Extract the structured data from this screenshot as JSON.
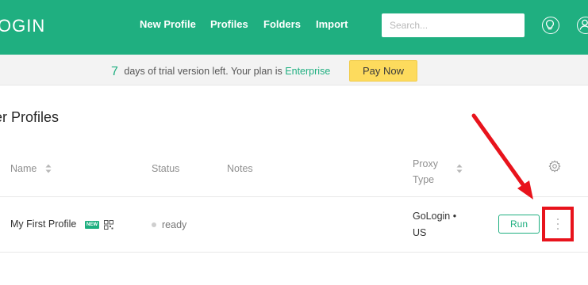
{
  "header": {
    "logo_text": "OGIN",
    "nav": [
      "New Profile",
      "Profiles",
      "Folders",
      "Import"
    ],
    "search_placeholder": "Search..."
  },
  "trial_banner": {
    "days": "7",
    "text": "days of trial version left. Your plan is",
    "plan": "Enterprise",
    "pay_label": "Pay Now"
  },
  "main": {
    "title": "er Profiles",
    "columns": [
      "Name",
      "Status",
      "Notes",
      "Proxy\nType"
    ],
    "rows": [
      {
        "name": "My First Profile",
        "badge": "NEW",
        "status": "ready",
        "notes": "",
        "proxy_line1": "GoLogin •",
        "proxy_line2": "US",
        "run_label": "Run"
      }
    ]
  },
  "icons": [
    "lightbulb-icon",
    "user-icon",
    "gear-icon",
    "sort-icon",
    "qr-icon",
    "more-vertical-icon",
    "arrow-annotation"
  ],
  "colors": {
    "brand": "#1faf80",
    "pay_button": "#fddb5d",
    "annotation": "#e8131c"
  }
}
